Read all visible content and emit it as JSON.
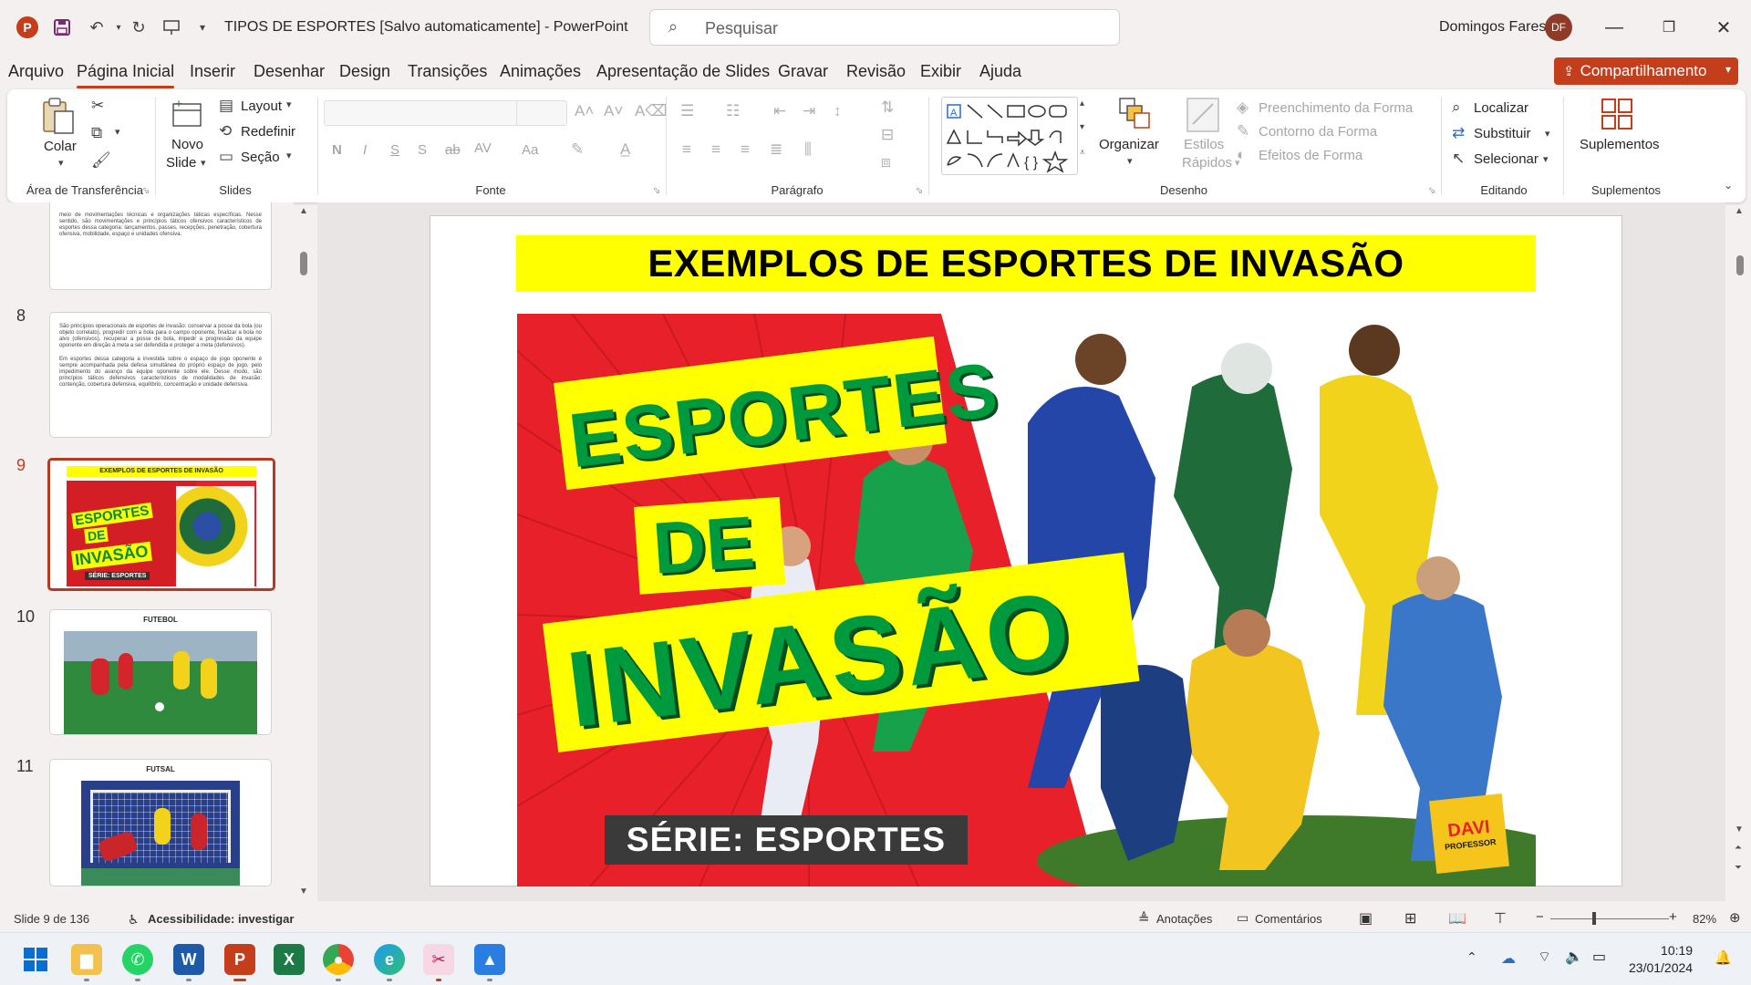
{
  "titlebar": {
    "app_logo": "P",
    "doc_title": "TIPOS DE ESPORTES [Salvo automaticamente]  -  PowerPoint",
    "search_placeholder": "Pesquisar",
    "user_name": "Domingos Fares",
    "user_initials": "DF"
  },
  "menu": {
    "tabs": [
      "Arquivo",
      "Página Inicial",
      "Inserir",
      "Desenhar",
      "Design",
      "Transições",
      "Animações",
      "Apresentação de Slides",
      "Gravar",
      "Revisão",
      "Exibir",
      "Ajuda"
    ],
    "active_tab": "Página Inicial",
    "share_label": "Compartilhamento"
  },
  "ribbon": {
    "clipboard": {
      "paste": "Colar",
      "group": "Área de Transferência"
    },
    "slides": {
      "new_slide_1": "Novo",
      "new_slide_2": "Slide",
      "layout": "Layout",
      "reset": "Redefinir",
      "section": "Seção",
      "group": "Slides"
    },
    "font": {
      "bold": "N",
      "italic": "I",
      "underline": "S",
      "shadow": "S",
      "strike": "ab",
      "spacing": "AV",
      "case": "Aa",
      "group": "Fonte"
    },
    "paragraph": {
      "group": "Parágrafo"
    },
    "drawing": {
      "arrange": "Organizar",
      "quick_styles_1": "Estilos",
      "quick_styles_2": "Rápidos",
      "fill": "Preenchimento da Forma",
      "outline": "Contorno da Forma",
      "effects": "Efeitos de Forma",
      "group": "Desenho"
    },
    "editing": {
      "find": "Localizar",
      "replace": "Substituir",
      "select": "Selecionar",
      "group": "Editando"
    },
    "addins": {
      "label": "Suplementos",
      "group": "Suplementos"
    }
  },
  "slides_panel": {
    "thumb8_text_a": "São princípios operacionais de esportes de invasão: conservar a posse da bola (ou objeto correlato), progredir com a bola para o campo oponente, finalizar a bola no alvo (ofensivos), recuperar a posse de bola, impedir a progressão da equipe oponente em direção à meta a ser defendida e proteger a meta (defensivos).",
    "thumb8_text_b": "Em esportes dessa categoria a investida sobre o espaço de jogo oponente é sempre acompanhada pela defesa simultânea do próprio espaço de jogo, pelo impedimento do avanço da equipe oponente sobre ele. Desse modo, são princípios táticos defensivos característicos de modalidades de invasão: contenção, cobertura defensiva, equilíbrio, concentração e unidade defensiva.",
    "thumb7_text": "meio de movimentações técnicas e organizações táticas específicas. Nesse sentido, são movimentações e princípios táticos ofensivos característicos de esportes dessa categoria: lançamentos, passes, recepções, penetração, cobertura ofensiva, mobilidade, espaço e unidades ofensiva.",
    "thumbs": [
      {
        "num": "8"
      },
      {
        "num": "9",
        "title": "EXEMPLOS DE ESPORTES DE INVASÃO"
      },
      {
        "num": "10",
        "title": "FUTEBOL"
      },
      {
        "num": "11",
        "title": "FUTSAL"
      }
    ]
  },
  "slide": {
    "title": "EXEMPLOS DE ESPORTES DE INVASÃO",
    "cover_word1": "ESPORTES",
    "cover_word2": "DE",
    "cover_word3": "INVASÃO",
    "series_label": "SÉRIE: ESPORTES",
    "brand_1": "DAVI",
    "brand_2": "PROFESSOR",
    "thumb_series": "SÉRIE: ESPORTES"
  },
  "status": {
    "slide_count": "Slide 9 de 136",
    "accessibility": "Acessibilidade: investigar",
    "notes": "Anotações",
    "comments": "Comentários",
    "zoom": "82%"
  },
  "taskbar": {
    "time": "10:19",
    "date": "23/01/2024"
  },
  "colors": {
    "accent": "#c43e1c",
    "title_yellow": "#ffff00",
    "cover_green": "#009a3e",
    "cover_red": "#e8202a"
  }
}
